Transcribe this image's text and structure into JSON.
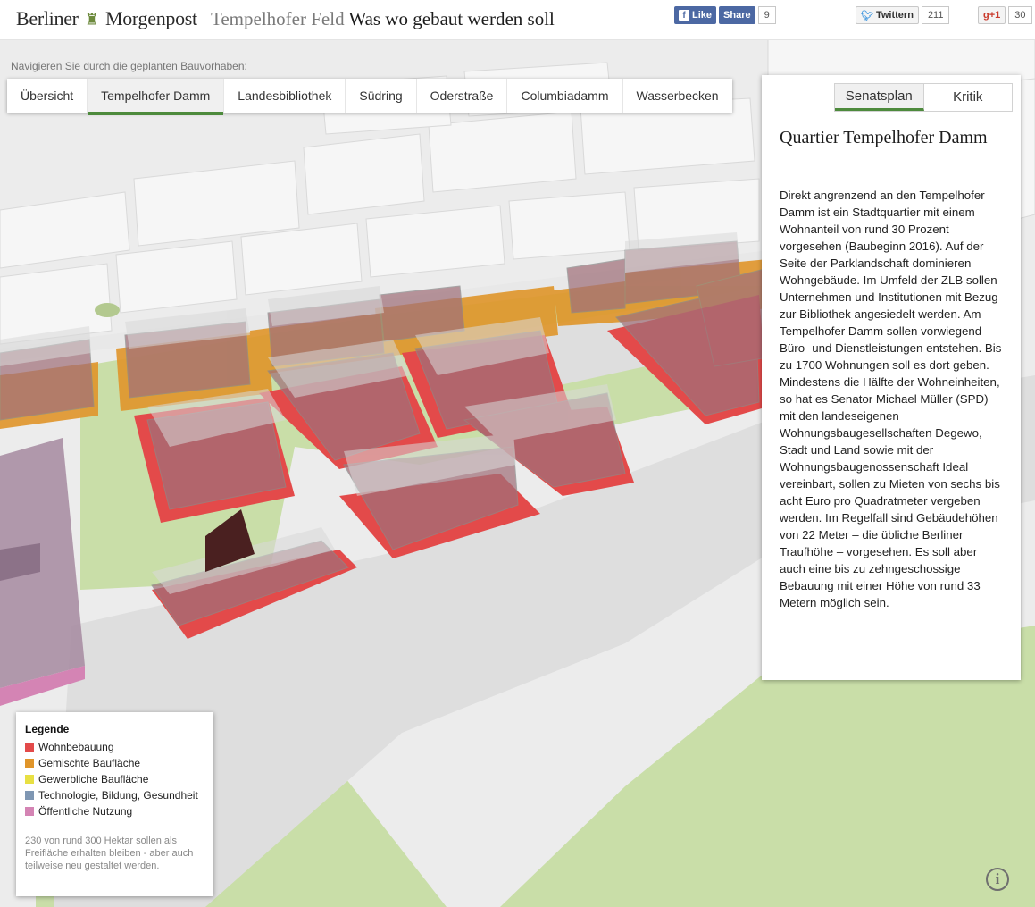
{
  "header": {
    "logo_left": "Berliner",
    "logo_right": "Morgenpost",
    "title_section": "Tempelhofer Feld",
    "title_main": "Was wo gebaut werden soll"
  },
  "social": {
    "facebook": {
      "like_label": "Like",
      "share_label": "Share",
      "count": "9"
    },
    "twitter": {
      "label": "Twittern",
      "count": "211"
    },
    "googleplus": {
      "label": "+1",
      "count": "30"
    }
  },
  "nav": {
    "hint": "Navigieren Sie durch die geplanten Bauvorhaben:",
    "tabs": [
      "Übersicht",
      "Tempelhofer Damm",
      "Landesbibliothek",
      "Südring",
      "Oderstraße",
      "Columbiadamm",
      "Wasserbecken"
    ],
    "active": "Tempelhofer Damm"
  },
  "panel": {
    "seg_tabs": [
      "Senatsplan",
      "Kritik"
    ],
    "active_seg": "Senatsplan",
    "title": "Quartier Tempelhofer Damm",
    "text": "Direkt angrenzend an den Tempelhofer Damm ist ein Stadtquartier mit einem Wohnanteil von rund 30 Prozent vorgesehen (Baubeginn 2016). Auf der Seite der Parklandschaft dominieren Wohngebäude. Im Umfeld der ZLB sollen Unternehmen und Institutionen mit Bezug zur Bibliothek angesiedelt werden. Am Tempelhofer Damm sollen vorwiegend Büro- und Dienstleistungen entstehen. Bis zu 1700 Wohnungen soll es dort geben. Mindestens die Hälfte der Wohneinheiten, so hat es Senator Michael Müller (SPD) mit den landeseigenen Wohnungsbaugesellschaften Degewo, Stadt und Land sowie mit der Wohnungsbaugenossenschaft Ideal vereinbart, sollen zu Mieten von sechs bis acht Euro pro Quadratmeter vergeben werden. Im Regelfall sind Gebäudehöhen von 22 Meter – die übliche Berliner Traufhöhe – vorgesehen. Es soll aber auch eine bis zu zehngeschossige Bebauung mit einer Höhe von rund 33 Metern möglich sein."
  },
  "legend": {
    "heading": "Legende",
    "items": [
      {
        "label": "Wohnbebauung",
        "color": "#e34a4a"
      },
      {
        "label": "Gemischte Baufläche",
        "color": "#e0952a"
      },
      {
        "label": "Gewerbliche Baufläche",
        "color": "#e8e043"
      },
      {
        "label": "Technologie, Bildung, Gesundheit",
        "color": "#7f97b3"
      },
      {
        "label": "Öffentliche Nutzung",
        "color": "#d484b4"
      }
    ],
    "note": "230 von rund 300 Hektar sollen als Freifläche erhalten bleiben - aber auch teilweise neu gestaltet werden."
  },
  "icons": {
    "info": "info-icon",
    "facebook": "facebook-icon",
    "twitter": "twitter-bird-icon",
    "crest": "crest-icon"
  },
  "colors": {
    "accent": "#4d8a3c",
    "residential": "#e34a4a",
    "mixed": "#e0952a",
    "green": "#c7dca5",
    "road": "#dedede"
  }
}
